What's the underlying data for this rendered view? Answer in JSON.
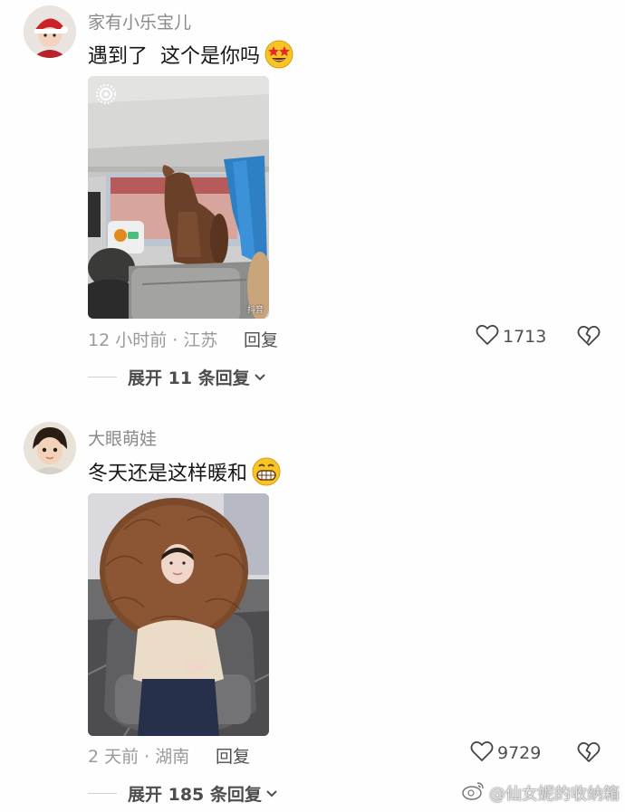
{
  "comments": [
    {
      "username": "家有小乐宝儿",
      "text": "遇到了  这个是你吗",
      "time_location": "12 小时前 · 江苏",
      "reply_label": "回复",
      "likes": "1713",
      "expand_label": "展开 11 条回复",
      "emoji": "star-struck-emoji"
    },
    {
      "username": "大眼萌娃",
      "text": "冬天还是这样暖和",
      "time_location": "2 天前 · 湖南",
      "reply_label": "回复",
      "likes": "9729",
      "expand_label": "展开 185 条回复",
      "emoji": "grinning-emoji"
    }
  ],
  "media": {
    "video_badge": "抖音"
  },
  "watermark": "@仙女妮的收纳箱"
}
